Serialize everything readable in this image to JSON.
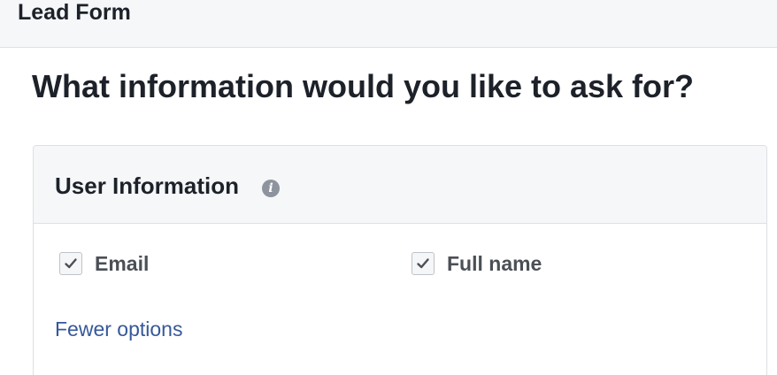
{
  "header": {
    "title": "Lead Form"
  },
  "main": {
    "question": "What information would you like to ask for?",
    "section": {
      "title": "User Information",
      "info_icon": "info-icon",
      "fields": [
        {
          "label": "Email",
          "checked": true
        },
        {
          "label": "Full name",
          "checked": true
        }
      ],
      "fewer_options_label": "Fewer options"
    }
  },
  "colors": {
    "link": "#365899",
    "header_bg": "#f6f7f9",
    "border": "#dddfe2",
    "text": "#1d2129",
    "field_label": "#4b4f56"
  }
}
